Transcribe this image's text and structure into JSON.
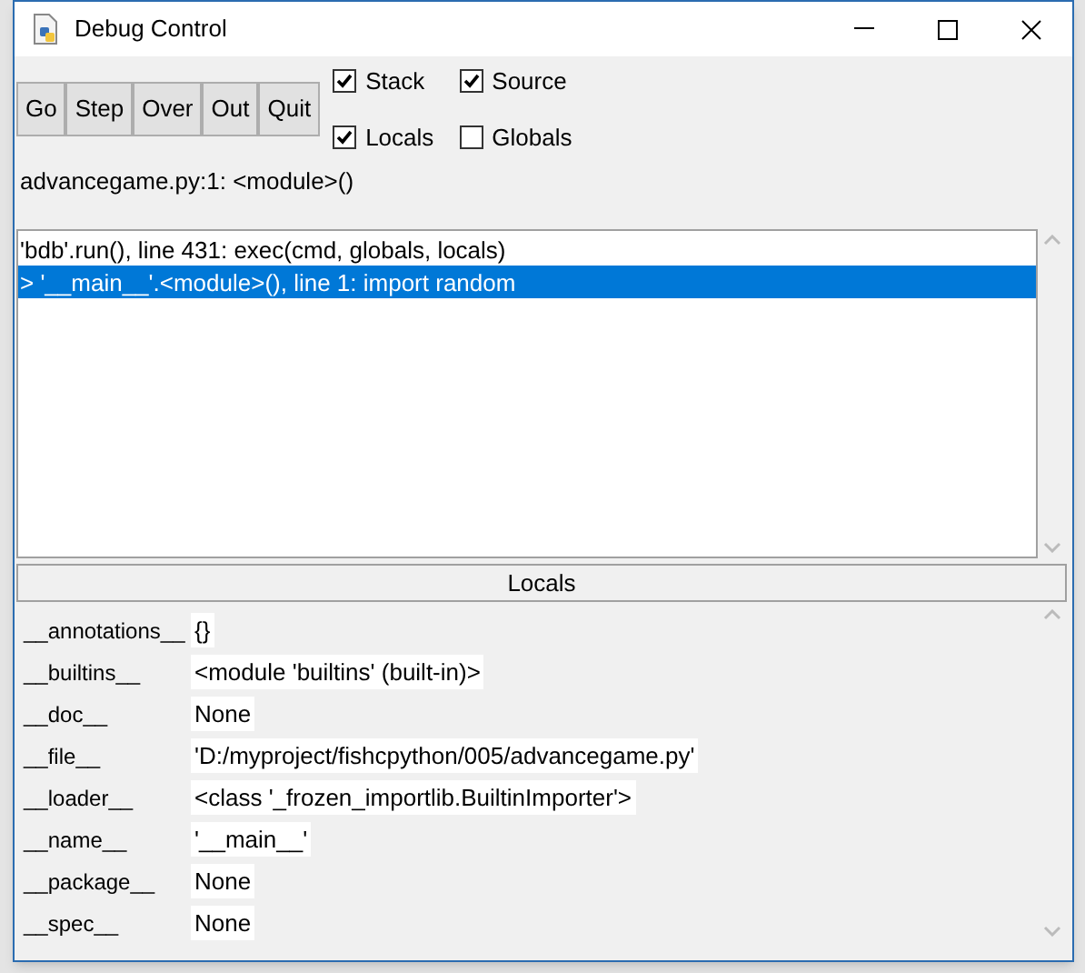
{
  "window": {
    "title": "Debug Control"
  },
  "buttons": [
    "Go",
    "Step",
    "Over",
    "Out",
    "Quit"
  ],
  "options": [
    {
      "label": "Stack",
      "checked": true
    },
    {
      "label": "Source",
      "checked": true
    },
    {
      "label": "Locals",
      "checked": true
    },
    {
      "label": "Globals",
      "checked": false
    }
  ],
  "status": "advancegame.py:1: <module>()",
  "stack": [
    {
      "text": "'bdb'.run(), line 431: exec(cmd, globals, locals)",
      "selected": false
    },
    {
      "text": "> '__main__'.<module>(), line 1: import random",
      "selected": true
    }
  ],
  "locals": {
    "title": "Locals",
    "rows": [
      {
        "name": "__annotations__",
        "value": "{}"
      },
      {
        "name": "__builtins__",
        "value": "<module 'builtins' (built-in)>"
      },
      {
        "name": "__doc__",
        "value": "None"
      },
      {
        "name": "__file__",
        "value": "'D:/myproject/fishcpython/005/advancegame.py'"
      },
      {
        "name": "__loader__",
        "value": "<class '_frozen_importlib.BuiltinImporter'>"
      },
      {
        "name": "__name__",
        "value": "'__main__'"
      },
      {
        "name": "__package__",
        "value": "None"
      },
      {
        "name": "__spec__",
        "value": "None"
      }
    ]
  }
}
